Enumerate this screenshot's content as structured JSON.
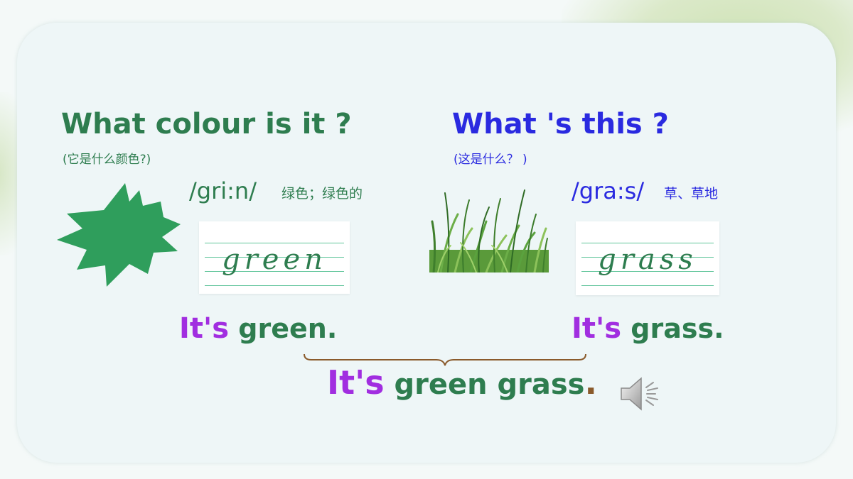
{
  "left": {
    "question": "What colour is it ?",
    "question_cn": "(它是什么颜色?)",
    "phonetic": "/gri:n/",
    "meaning_cn": "绿色；绿色的",
    "writing_word": "green",
    "answer": {
      "part1": "It's",
      "part2": " green."
    }
  },
  "right": {
    "question": "What 's this ?",
    "question_cn": "(这是什么？ )",
    "phonetic": "/gra:s/",
    "meaning_cn": "草、草地",
    "writing_word": "grass",
    "answer": {
      "part1": "It's",
      "part2": " grass."
    }
  },
  "combined": {
    "part1": "It's",
    "part2": " green grass",
    "part3": "."
  },
  "icons": {
    "shape": "green-star-icon",
    "picture": "grass-image",
    "audio": "speaker-icon"
  },
  "colors": {
    "green": "#2e7d4f",
    "blue": "#2a2ae0",
    "purple": "#a12ee0",
    "star": "#2f9e5c",
    "brown": "#8a5a2b"
  }
}
